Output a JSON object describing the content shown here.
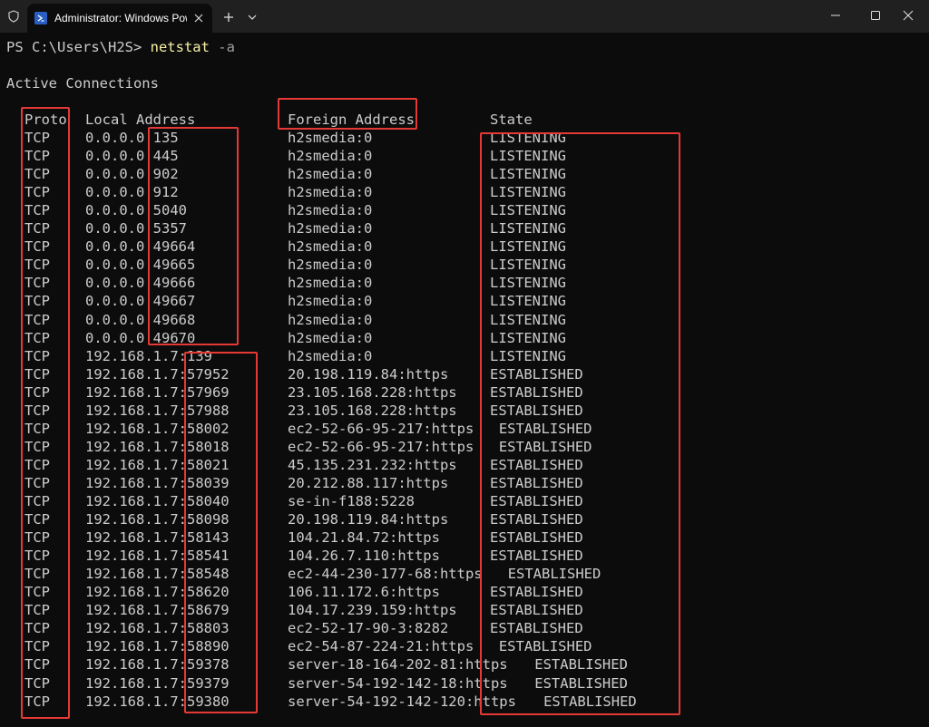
{
  "window": {
    "tab_title": "Administrator: Windows PowerShell",
    "colors": {
      "background": "#0c0c0c",
      "titlebar": "#202020",
      "text": "#cccccc",
      "command": "#f9f1a5",
      "highlight": "#e53935"
    }
  },
  "terminal": {
    "prompt": "PS C:\\Users\\H2S> ",
    "command": "netstat",
    "param": " -a",
    "heading": "Active Connections",
    "headers": {
      "proto": "Proto",
      "local": "Local Address",
      "foreign": "Foreign Address",
      "state": "State"
    },
    "rows": [
      {
        "proto": "TCP",
        "local": "0.0.0.0:135",
        "foreign": "h2smedia:0",
        "state": "LISTENING"
      },
      {
        "proto": "TCP",
        "local": "0.0.0.0:445",
        "foreign": "h2smedia:0",
        "state": "LISTENING"
      },
      {
        "proto": "TCP",
        "local": "0.0.0.0:902",
        "foreign": "h2smedia:0",
        "state": "LISTENING"
      },
      {
        "proto": "TCP",
        "local": "0.0.0.0:912",
        "foreign": "h2smedia:0",
        "state": "LISTENING"
      },
      {
        "proto": "TCP",
        "local": "0.0.0.0:5040",
        "foreign": "h2smedia:0",
        "state": "LISTENING"
      },
      {
        "proto": "TCP",
        "local": "0.0.0.0:5357",
        "foreign": "h2smedia:0",
        "state": "LISTENING"
      },
      {
        "proto": "TCP",
        "local": "0.0.0.0:49664",
        "foreign": "h2smedia:0",
        "state": "LISTENING"
      },
      {
        "proto": "TCP",
        "local": "0.0.0.0:49665",
        "foreign": "h2smedia:0",
        "state": "LISTENING"
      },
      {
        "proto": "TCP",
        "local": "0.0.0.0:49666",
        "foreign": "h2smedia:0",
        "state": "LISTENING"
      },
      {
        "proto": "TCP",
        "local": "0.0.0.0:49667",
        "foreign": "h2smedia:0",
        "state": "LISTENING"
      },
      {
        "proto": "TCP",
        "local": "0.0.0.0:49668",
        "foreign": "h2smedia:0",
        "state": "LISTENING"
      },
      {
        "proto": "TCP",
        "local": "0.0.0.0:49670",
        "foreign": "h2smedia:0",
        "state": "LISTENING"
      },
      {
        "proto": "TCP",
        "local": "192.168.1.7:139",
        "foreign": "h2smedia:0",
        "state": "LISTENING"
      },
      {
        "proto": "TCP",
        "local": "192.168.1.7:57952",
        "foreign": "20.198.119.84:https",
        "state": "ESTABLISHED"
      },
      {
        "proto": "TCP",
        "local": "192.168.1.7:57969",
        "foreign": "23.105.168.228:https",
        "state": "ESTABLISHED"
      },
      {
        "proto": "TCP",
        "local": "192.168.1.7:57988",
        "foreign": "23.105.168.228:https",
        "state": "ESTABLISHED"
      },
      {
        "proto": "TCP",
        "local": "192.168.1.7:58002",
        "foreign": "ec2-52-66-95-217:https",
        "state": "ESTABLISHED"
      },
      {
        "proto": "TCP",
        "local": "192.168.1.7:58018",
        "foreign": "ec2-52-66-95-217:https",
        "state": "ESTABLISHED"
      },
      {
        "proto": "TCP",
        "local": "192.168.1.7:58021",
        "foreign": "45.135.231.232:https",
        "state": "ESTABLISHED"
      },
      {
        "proto": "TCP",
        "local": "192.168.1.7:58039",
        "foreign": "20.212.88.117:https",
        "state": "ESTABLISHED"
      },
      {
        "proto": "TCP",
        "local": "192.168.1.7:58040",
        "foreign": "se-in-f188:5228",
        "state": "ESTABLISHED"
      },
      {
        "proto": "TCP",
        "local": "192.168.1.7:58098",
        "foreign": "20.198.119.84:https",
        "state": "ESTABLISHED"
      },
      {
        "proto": "TCP",
        "local": "192.168.1.7:58143",
        "foreign": "104.21.84.72:https",
        "state": "ESTABLISHED"
      },
      {
        "proto": "TCP",
        "local": "192.168.1.7:58541",
        "foreign": "104.26.7.110:https",
        "state": "ESTABLISHED"
      },
      {
        "proto": "TCP",
        "local": "192.168.1.7:58548",
        "foreign": "ec2-44-230-177-68:https",
        "state": "ESTABLISHED"
      },
      {
        "proto": "TCP",
        "local": "192.168.1.7:58620",
        "foreign": "106.11.172.6:https",
        "state": "ESTABLISHED"
      },
      {
        "proto": "TCP",
        "local": "192.168.1.7:58679",
        "foreign": "104.17.239.159:https",
        "state": "ESTABLISHED"
      },
      {
        "proto": "TCP",
        "local": "192.168.1.7:58803",
        "foreign": "ec2-52-17-90-3:8282",
        "state": "ESTABLISHED"
      },
      {
        "proto": "TCP",
        "local": "192.168.1.7:58890",
        "foreign": "ec2-54-87-224-21:https",
        "state": "ESTABLISHED"
      },
      {
        "proto": "TCP",
        "local": "192.168.1.7:59378",
        "foreign": "server-18-164-202-81:https",
        "state": "ESTABLISHED"
      },
      {
        "proto": "TCP",
        "local": "192.168.1.7:59379",
        "foreign": "server-54-192-142-18:https",
        "state": "ESTABLISHED"
      },
      {
        "proto": "TCP",
        "local": "192.168.1.7:59380",
        "foreign": "server-54-192-142-120:https",
        "state": "ESTABLISHED"
      }
    ]
  }
}
